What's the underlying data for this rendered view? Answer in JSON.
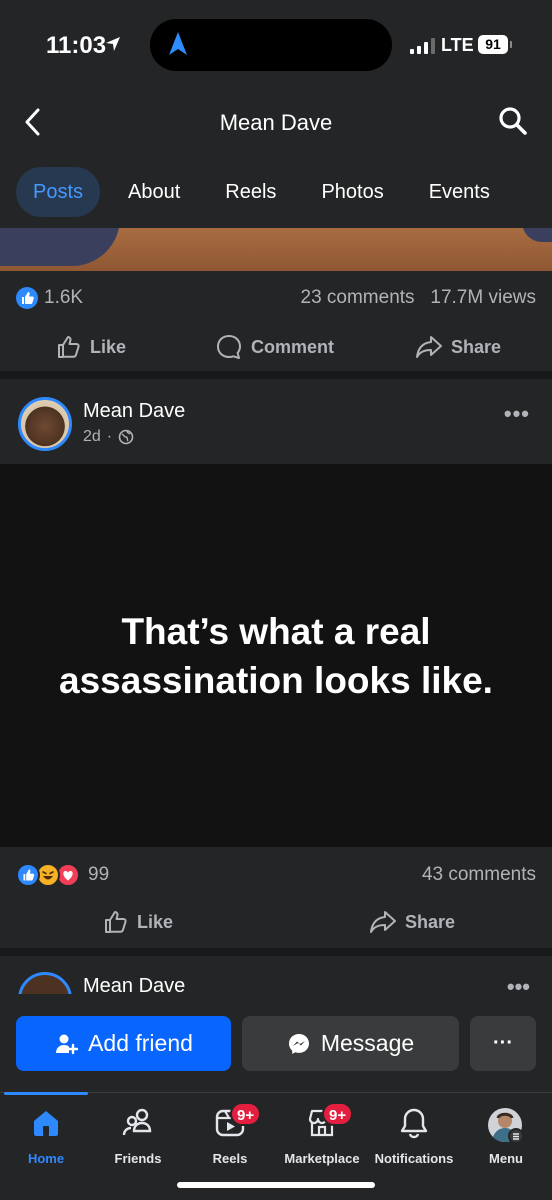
{
  "status_bar": {
    "time": "11:03",
    "network": "LTE",
    "battery": "91"
  },
  "header": {
    "title": "Mean Dave"
  },
  "tabs": [
    {
      "label": "Posts",
      "active": true
    },
    {
      "label": "About"
    },
    {
      "label": "Reels"
    },
    {
      "label": "Photos"
    },
    {
      "label": "Events"
    }
  ],
  "post1": {
    "reactions_count": "1.6K",
    "comments": "23 comments",
    "views": "17.7M views",
    "actions": {
      "like": "Like",
      "comment": "Comment",
      "share": "Share"
    }
  },
  "post2": {
    "author": "Mean Dave",
    "time": "2d",
    "separator": "·",
    "text": "That’s what a real assassination looks like.",
    "reactions_count": "99",
    "comments": "43 comments",
    "actions": {
      "like": "Like",
      "share": "Share"
    }
  },
  "post3": {
    "author": "Mean Dave"
  },
  "cta": {
    "add_friend": "Add friend",
    "message": "Message",
    "more": "···"
  },
  "nav": [
    {
      "label": "Home",
      "icon": "home-icon",
      "active": true
    },
    {
      "label": "Friends",
      "icon": "friends-icon"
    },
    {
      "label": "Reels",
      "icon": "reels-icon",
      "badge": "9+"
    },
    {
      "label": "Marketplace",
      "icon": "marketplace-icon",
      "badge": "9+"
    },
    {
      "label": "Notifications",
      "icon": "bell-icon"
    },
    {
      "label": "Menu",
      "icon": "menu-avatar-icon"
    }
  ],
  "colors": {
    "accent": "#2e89ff",
    "primary_button": "#0866ff",
    "badge": "#e41e3f",
    "background": "#242526"
  }
}
